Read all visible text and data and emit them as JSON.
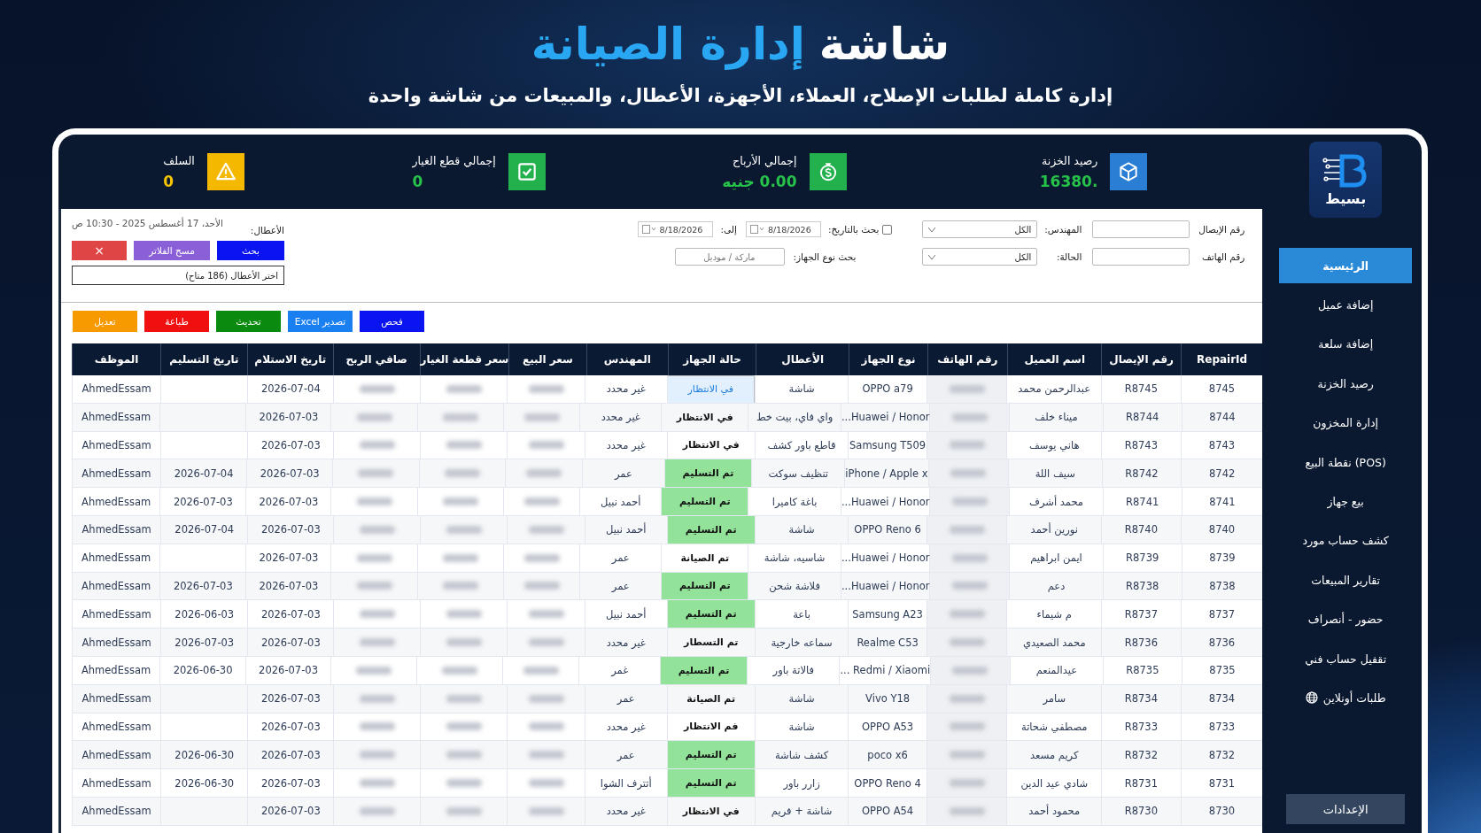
{
  "header": {
    "title_prefix": "شاشة",
    "title_highlight": "إدارة الصيانة",
    "subtitle": "إدارة كاملة لطلبات الإصلاح، العملاء، الأجهزة، الأعطال، والمبيعات من شاشة واحدة"
  },
  "logo": {
    "text": "بسيط"
  },
  "stats": [
    {
      "label": "رصيد الخزنة",
      "value": "16380.",
      "kind": "box",
      "color": "#2a7fd4"
    },
    {
      "label": "إجمالي الأرباح",
      "value": "0.00 جنيه",
      "kind": "dollar",
      "color": "#22b14c"
    },
    {
      "label": "إجمالي قطع الغيار",
      "value": "0",
      "kind": "check",
      "color": "#22b14c"
    },
    {
      "label": "السلف",
      "value": "0",
      "kind": "warning",
      "color": "#f5b800"
    }
  ],
  "filters": {
    "receipt_label": "رقم الإيصال",
    "phone_label": "رقم الهاتف",
    "engineer_label": "المهندس:",
    "engineer_value": "الكل",
    "status_label": "الحالة:",
    "status_value": "الكل",
    "date_search_label": "بحث بالتاريخ:",
    "date_search_checked": false,
    "date_from": "8/18/2026",
    "to_label": "إلى:",
    "date_to": "8/18/2026",
    "device_label": "بحث نوع الجهاز:",
    "device_placeholder": "ماركة / موديل",
    "datetime": "الأحد، 17 أغسطس 2025 - 10:30 ص",
    "faults_label": "الأعطال:",
    "search_button": "بحث",
    "clear_button": "مسح الفلاتر",
    "close_button": "×",
    "faults_select": "اختر الأعطال (186 متاح)"
  },
  "toolbar": [
    {
      "label": "فحص",
      "color": "#0a14f0"
    },
    {
      "label": "تصدير Excel",
      "color": "#1a7ff0"
    },
    {
      "label": "تحديث",
      "color": "#0b8a10"
    },
    {
      "label": "طباعة",
      "color": "#f01010"
    },
    {
      "label": "تعديل",
      "color": "#f79a00"
    }
  ],
  "table": {
    "columns": [
      {
        "label": "RepairId",
        "kind": "id"
      },
      {
        "label": "رقم الإيصال",
        "kind": "receipt"
      },
      {
        "label": "اسم العميل",
        "kind": "customer"
      },
      {
        "label": "رقم الهاتف",
        "kind": "phone"
      },
      {
        "label": "نوع الجهاز",
        "kind": "device"
      },
      {
        "label": "الأعطال",
        "kind": "faults"
      },
      {
        "label": "حالة الجهاز",
        "kind": "status"
      },
      {
        "label": "المهندس",
        "kind": "engineer"
      },
      {
        "label": "سعر البيع",
        "kind": "sale"
      },
      {
        "label": "سعر قطعة الغيار",
        "kind": "parts"
      },
      {
        "label": "صافي الربح",
        "kind": "profit"
      },
      {
        "label": "تاريخ الاستلام",
        "kind": "received"
      },
      {
        "label": "تاريخ التسليم",
        "kind": "delivered"
      },
      {
        "label": "الموظف",
        "kind": "employee"
      }
    ],
    "rows": [
      {
        "id": "8745",
        "receipt": "R8745",
        "customer": "عبدالرحمن محمد",
        "device": "OPPO a79",
        "faults": "شاشة",
        "status": "في الانتظار",
        "selected": true,
        "engineer": "غير محدد",
        "received": "2026-07-04",
        "employee": "AhmedEssam"
      },
      {
        "id": "8744",
        "receipt": "R8744",
        "customer": "ميناء خلف",
        "device": "Huawei / Honor...",
        "faults": "واي فاي، بيت خط",
        "status": "في الانتظار",
        "selected": false,
        "engineer": "غير محدد",
        "received": "2026-07-03",
        "employee": "AhmedEssam"
      },
      {
        "id": "8743",
        "receipt": "R8743",
        "customer": "هاني يوسف",
        "device": "Samsung T509",
        "faults": "قاطع باور كشف",
        "status": "في الانتظار",
        "selected": false,
        "engineer": "غير محدد",
        "received": "2026-07-03",
        "employee": "AhmedEssam"
      },
      {
        "id": "8742",
        "receipt": "R8742",
        "customer": "سيف اللة",
        "device": "iPhone / Apple x",
        "faults": "تنظيف سوكت",
        "status": "تم التسليم",
        "color": "#93e29a",
        "selected": false,
        "engineer": "عمر",
        "received": "2026-07-03",
        "delivered": "2026-07-04",
        "employee": "AhmedEssam"
      },
      {
        "id": "8741",
        "receipt": "R8741",
        "customer": "محمد أشرف",
        "device": "Huawei / Honor...",
        "faults": "باغة كاميرا",
        "status": "تم التسليم",
        "color": "#93e29a",
        "selected": false,
        "engineer": "أحمد نبيل",
        "received": "2026-07-03",
        "delivered": "2026-07-03",
        "employee": "AhmedEssam"
      },
      {
        "id": "8740",
        "receipt": "R8740",
        "customer": "نورين أحمد",
        "device": "OPPO Reno 6",
        "faults": "شاشة",
        "status": "تم التسليم",
        "color": "#93e29a",
        "selected": false,
        "engineer": "أحمد نبيل",
        "received": "2026-07-03",
        "delivered": "2026-07-04",
        "employee": "AhmedEssam"
      },
      {
        "id": "8739",
        "receipt": "R8739",
        "customer": "ايمن ابراهيم",
        "device": "Huawei / Honor...",
        "faults": "شاسيه، شاشة",
        "status": "تم الصيانة",
        "selected": false,
        "engineer": "عمر",
        "received": "2026-07-03",
        "employee": "AhmedEssam"
      },
      {
        "id": "8738",
        "receipt": "R8738",
        "customer": "دعم",
        "device": "Huawei / Honor...",
        "faults": "فلاشة شحن",
        "status": "تم التسليم",
        "color": "#93e29a",
        "selected": false,
        "engineer": "عمر",
        "received": "2026-07-03",
        "delivered": "2026-07-03",
        "employee": "AhmedEssam"
      },
      {
        "id": "8737",
        "receipt": "R8737",
        "customer": "م شيماء",
        "device": "Samsung A23",
        "faults": "باعة",
        "status": "تم التسليم",
        "color": "#93e29a",
        "selected": false,
        "engineer": "أحمد نبيل",
        "received": "2026-07-03",
        "delivered": "2026-06-03",
        "employee": "AhmedEssam"
      },
      {
        "id": "8736",
        "receipt": "R8736",
        "customer": "محمد الصعيدي",
        "device": "Realme C53",
        "faults": "سماعه خارجية",
        "status": "تم التسطار",
        "selected": false,
        "engineer": "غير محدد",
        "received": "2026-07-03",
        "delivered": "2026-07-03",
        "employee": "AhmedEssam"
      },
      {
        "id": "8735",
        "receipt": "R8735",
        "customer": "عيدالمنعم",
        "device": "Redmi / Xiaomi ...",
        "faults": "فالاتة باور",
        "status": "تم التسليم",
        "color": "#93e29a",
        "selected": false,
        "engineer": "غمر",
        "received": "2026-07-03",
        "delivered": "2026-06-30",
        "employee": "AhmedEssam"
      },
      {
        "id": "8734",
        "receipt": "R8734",
        "customer": "سامر",
        "device": "Vivo Y18",
        "faults": "شاشة",
        "status": "تم الصيانة",
        "selected": false,
        "engineer": "عمر",
        "received": "2026-07-03",
        "employee": "AhmedEssam"
      },
      {
        "id": "8733",
        "receipt": "R8733",
        "customer": "مصطفي شحاتة",
        "device": "OPPO A53",
        "faults": "شاشة",
        "status": "فم الانتظار",
        "selected": false,
        "engineer": "غير محدد",
        "received": "2026-07-03",
        "employee": "AhmedEssam"
      },
      {
        "id": "8732",
        "receipt": "R8732",
        "customer": "كريم مسعد",
        "device": "poco x6",
        "faults": "كشف شاشة",
        "status": "تم التسليم",
        "color": "#93e29a",
        "selected": false,
        "engineer": "عمر",
        "received": "2026-07-03",
        "delivered": "2026-06-30",
        "employee": "AhmedEssam"
      },
      {
        "id": "8731",
        "receipt": "R8731",
        "customer": "شادي عيد الدين",
        "device": "OPPO Reno 4",
        "faults": "زارر باور",
        "status": "تم التسليم",
        "color": "#93e29a",
        "selected": false,
        "engineer": "أتترف الشوا",
        "received": "2026-07-03",
        "delivered": "2026-06-30",
        "employee": "AhmedEssam"
      },
      {
        "id": "8730",
        "receipt": "R8730",
        "customer": "محمود أحمد",
        "device": "OPPO A54",
        "faults": "شاشة + فريم",
        "status": "في الانتظار",
        "selected": false,
        "engineer": "غير محدد",
        "received": "2026-07-03",
        "employee": "AhmedEssam"
      }
    ]
  },
  "sidebar": {
    "items": [
      {
        "label": "الرئيسية",
        "selected": true
      },
      {
        "label": "إضافة عميل",
        "selected": false
      },
      {
        "label": "إضافة سلعة",
        "selected": false
      },
      {
        "label": "رصيد الخزنة",
        "selected": false
      },
      {
        "label": "إدارة المخزون",
        "selected": false
      },
      {
        "label": "(POS) نقطة البيع",
        "selected": false
      },
      {
        "label": "بيع جهاز",
        "selected": false
      },
      {
        "label": "كشف حساب مورد",
        "selected": false
      },
      {
        "label": "تقارير المبيعات",
        "selected": false
      },
      {
        "label": "حضور - أنصراف",
        "selected": false
      },
      {
        "label": "تقفيل حساب فني",
        "selected": false
      },
      {
        "label": "طلبات أونلاين",
        "selected": false,
        "kind": "globe"
      }
    ],
    "settings": "الإعدادات"
  }
}
